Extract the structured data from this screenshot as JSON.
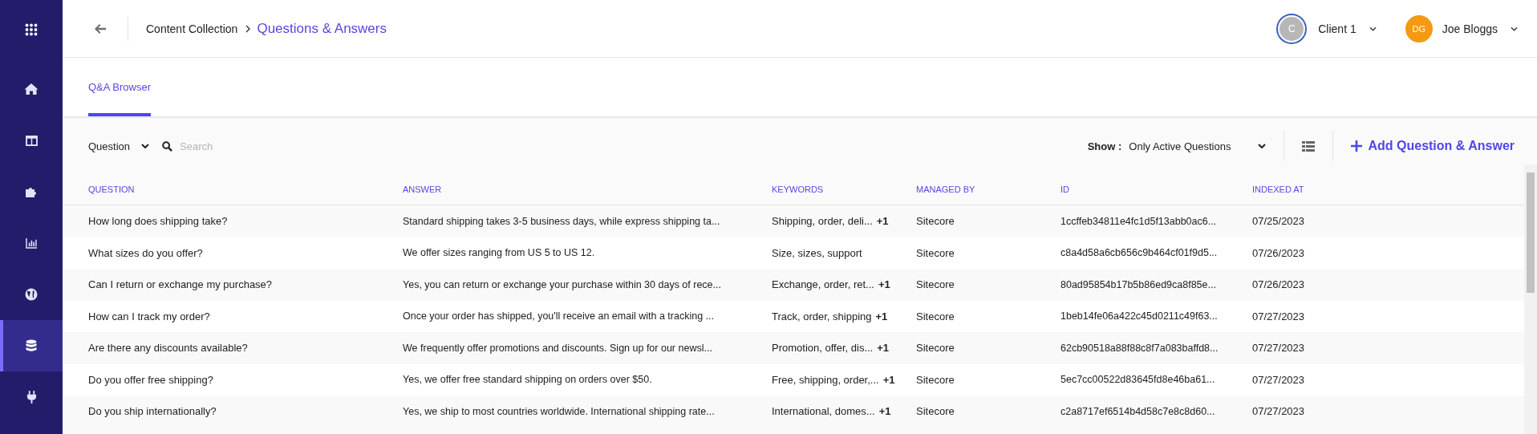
{
  "sidebar": {
    "items": [
      {
        "selected": false
      },
      {
        "selected": false
      },
      {
        "selected": false
      },
      {
        "selected": false
      },
      {
        "selected": false
      },
      {
        "selected": true
      },
      {
        "selected": false
      }
    ]
  },
  "header": {
    "breadcrumb": "Content Collection",
    "title": "Questions & Answers",
    "client": {
      "initial": "C",
      "name": "Client 1"
    },
    "user": {
      "initials": "DG",
      "name": "Joe Bloggs"
    }
  },
  "tabs": [
    {
      "label": "Q&A Browser",
      "selected": true
    }
  ],
  "toolbar": {
    "filter": "Question",
    "search": {
      "placeholder": "Search"
    },
    "show_label": "Show :",
    "show_value": "Only Active Questions",
    "add_button": "Add Question & Answer"
  },
  "table": {
    "columns": [
      "QUESTION",
      "ANSWER",
      "KEYWORDS",
      "MANAGED BY",
      "ID",
      "INDEXED AT"
    ],
    "rows": [
      {
        "question": "How long does shipping take?",
        "answer": "Standard shipping takes 3-5 business days, while express shipping ta...",
        "keywords": "Shipping, order, deli...",
        "more": "+1",
        "managed_by": "Sitecore",
        "id": "1ccffeb34811e4fc1d5f13abb0ac6...",
        "indexed_at": "07/25/2023"
      },
      {
        "question": "What sizes do you offer?",
        "answer": "We offer sizes ranging from US 5 to US 12.",
        "keywords": "Size, sizes, support",
        "managed_by": "Sitecore",
        "id": "c8a4d58a6cb656c9b464cf01f9d5...",
        "indexed_at": "07/26/2023"
      },
      {
        "question": "Can I return or exchange my purchase?",
        "answer": "Yes, you can return or exchange your purchase within 30 days of rece...",
        "keywords": "Exchange, order, ret...",
        "more": "+1",
        "managed_by": "Sitecore",
        "id": "80ad95854b17b5b86ed9ca8f85e...",
        "indexed_at": "07/26/2023"
      },
      {
        "question": "How can I track my order?",
        "answer": "Once your order has shipped, you'll receive an email with a tracking ...",
        "keywords": "Track, order, shipping",
        "more": "+1",
        "managed_by": "Sitecore",
        "id": "1beb14fe06a422c45d0211c49f63...",
        "indexed_at": "07/27/2023"
      },
      {
        "question": "Are there any discounts available?",
        "answer": "We frequently offer promotions and discounts. Sign up for our newsl...",
        "keywords": "Promotion, offer, dis...",
        "more": "+1",
        "managed_by": "Sitecore",
        "id": "62cb90518a88f88c8f7a083baffd8...",
        "indexed_at": "07/27/2023"
      },
      {
        "question": "Do you offer free shipping?",
        "answer": "Yes, we offer free standard shipping on orders over $50.",
        "keywords": "Free, shipping, order,...",
        "more": "+1",
        "managed_by": "Sitecore",
        "id": "5ec7cc00522d83645fd8e46ba61...",
        "indexed_at": "07/27/2023"
      },
      {
        "question": "Do you ship internationally?",
        "answer": "Yes, we ship to most countries worldwide. International shipping rate...",
        "keywords": "International, domes...",
        "more": "+1",
        "managed_by": "Sitecore",
        "id": "c2a8717ef6514b4d58c7e8c8d60...",
        "indexed_at": "07/27/2023"
      }
    ]
  }
}
